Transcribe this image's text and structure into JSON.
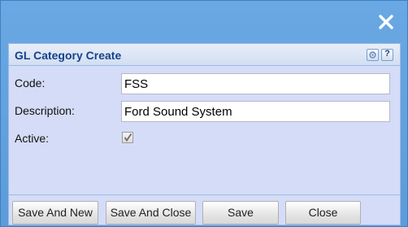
{
  "dialog": {
    "close_icon": "close-icon",
    "title": "GL Category Create",
    "tools": {
      "settings_icon": "gear-icon",
      "help_icon": "help-icon",
      "help_glyph": "?"
    }
  },
  "form": {
    "code": {
      "label": "Code:",
      "value": "FSS"
    },
    "description": {
      "label": "Description:",
      "value": "Ford Sound System"
    },
    "active": {
      "label": "Active:",
      "checked": true
    }
  },
  "buttons": {
    "save_and_new": "Save And New",
    "save_and_close": "Save And Close",
    "save": "Save",
    "close": "Close"
  },
  "colors": {
    "window_bg": "#5f9fdc",
    "panel_bg": "#d5dcf7",
    "title_text": "#15428b"
  }
}
